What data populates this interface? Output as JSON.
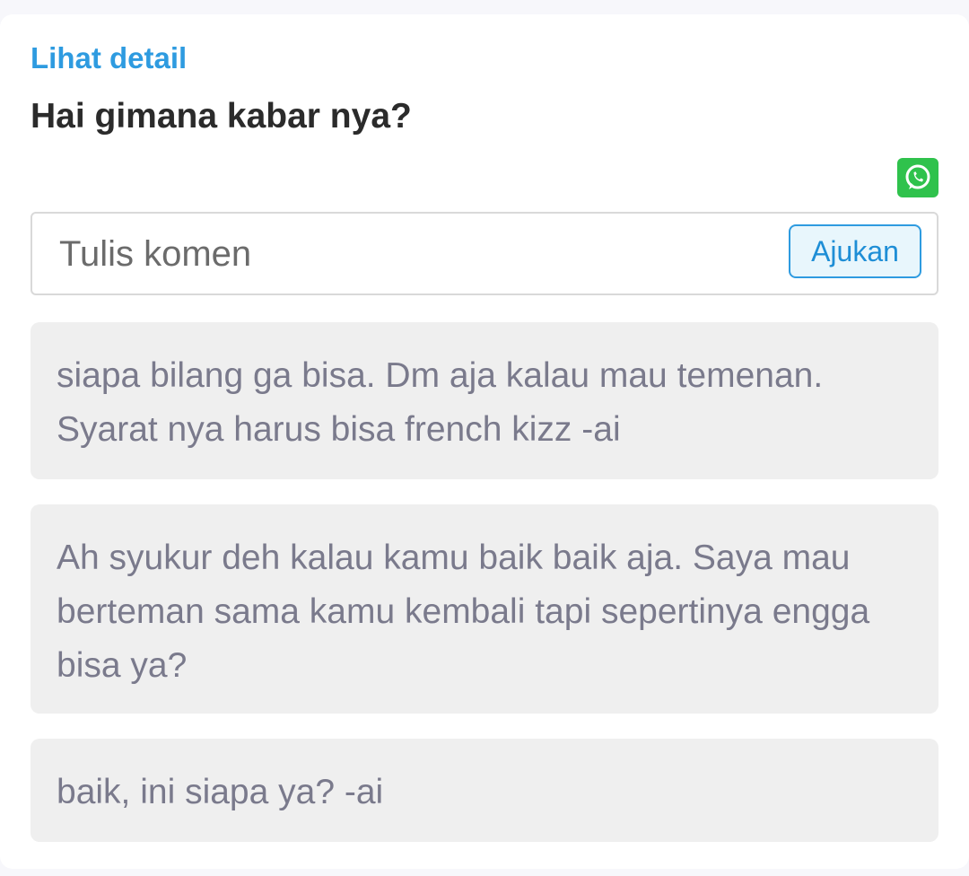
{
  "detail_link": "Lihat detail",
  "question": "Hai gimana kabar nya?",
  "share": {
    "icon": "whatsapp-icon",
    "color": "#2fc24c"
  },
  "comment_form": {
    "placeholder": "Tulis komen",
    "value": "",
    "submit_label": "Ajukan"
  },
  "comments": [
    {
      "text": "siapa bilang ga bisa. Dm aja kalau mau temenan. Syarat nya harus bisa french kizz -ai"
    },
    {
      "text": "Ah syukur deh kalau kamu baik baik aja. Saya mau berteman sama kamu kembali tapi sepertinya engga bisa ya?"
    },
    {
      "text": "baik, ini siapa ya? -ai"
    }
  ],
  "colors": {
    "accent": "#2e9be0",
    "comment_bg": "#efefef",
    "comment_text": "#7a7a8c"
  }
}
